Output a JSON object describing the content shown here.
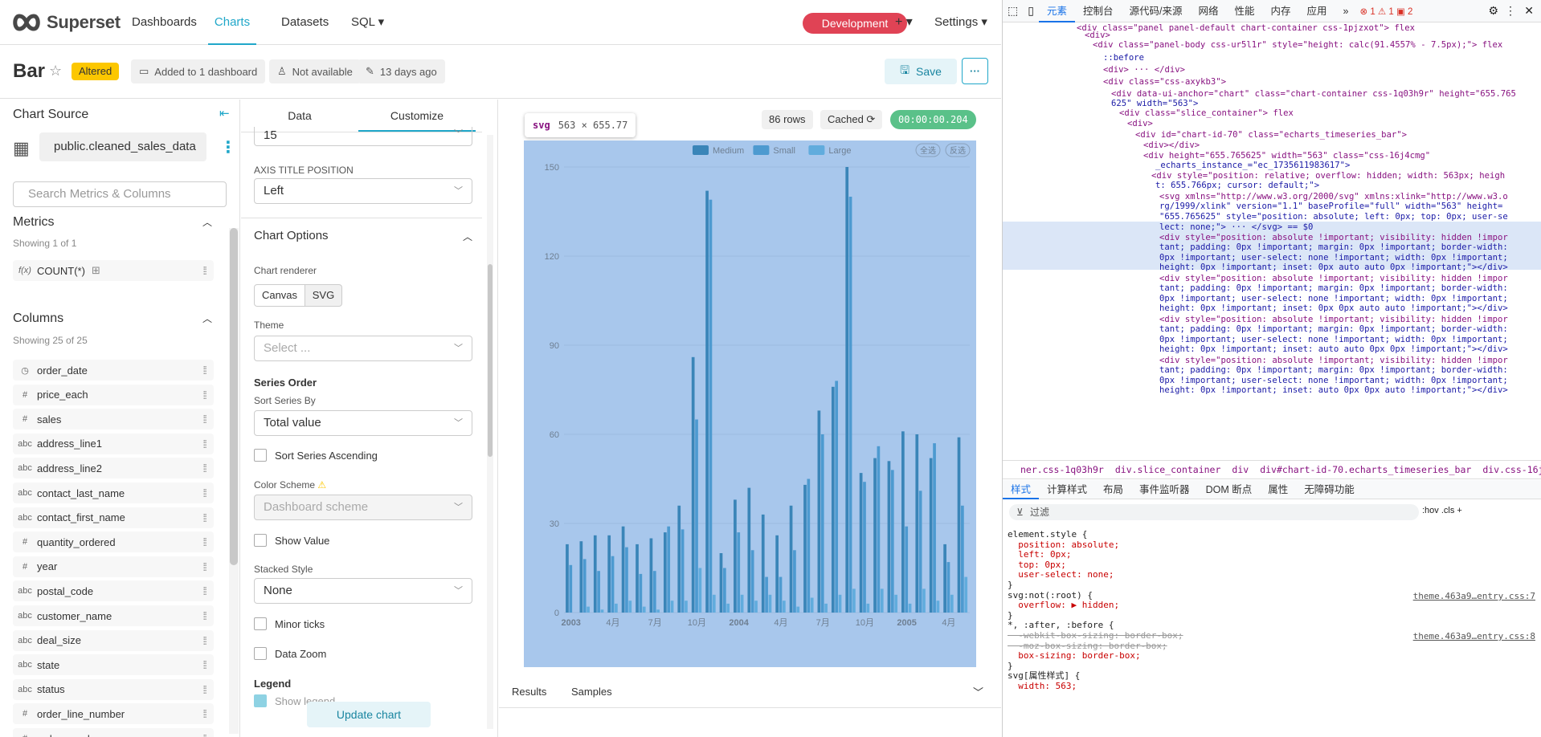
{
  "nav": {
    "brand": "Superset",
    "links": [
      "Dashboards",
      "Charts",
      "Datasets",
      "SQL ▾"
    ],
    "env_badge": "Development",
    "plus_label": "+ ▾",
    "settings": "Settings ▾"
  },
  "header": {
    "title": "Bar",
    "status": "Altered",
    "meta": [
      "Added to 1 dashboard",
      "Not available",
      "13 days ago"
    ],
    "save": "Save",
    "more": "···"
  },
  "left": {
    "chart_source": "Chart Source",
    "dataset": "public.cleaned_sales_data",
    "search_placeholder": "Search Metrics & Columns",
    "metrics_h": "Metrics",
    "metrics_showing": "Showing 1 of 1",
    "metric": {
      "type": "f(x)",
      "name": "COUNT(*)"
    },
    "columns_h": "Columns",
    "columns_showing": "Showing 25 of 25",
    "columns": [
      {
        "type": "◷",
        "name": "order_date"
      },
      {
        "type": "#",
        "name": "price_each"
      },
      {
        "type": "#",
        "name": "sales"
      },
      {
        "type": "abc",
        "name": "address_line1"
      },
      {
        "type": "abc",
        "name": "address_line2"
      },
      {
        "type": "abc",
        "name": "contact_last_name"
      },
      {
        "type": "abc",
        "name": "contact_first_name"
      },
      {
        "type": "#",
        "name": "quantity_ordered"
      },
      {
        "type": "#",
        "name": "year"
      },
      {
        "type": "abc",
        "name": "postal_code"
      },
      {
        "type": "abc",
        "name": "customer_name"
      },
      {
        "type": "abc",
        "name": "deal_size"
      },
      {
        "type": "abc",
        "name": "state"
      },
      {
        "type": "abc",
        "name": "status"
      },
      {
        "type": "#",
        "name": "order_line_number"
      },
      {
        "type": "#",
        "name": "order_number"
      }
    ]
  },
  "customize": {
    "tabs": [
      "Data",
      "Customize"
    ],
    "font_value": "15",
    "axis_title_position_label": "AXIS TITLE POSITION",
    "axis_title_position": "Left",
    "chart_options": "Chart Options",
    "renderer_label": "Chart renderer",
    "renderer_opts": [
      "Canvas",
      "SVG"
    ],
    "theme_label": "Theme",
    "theme_placeholder": "Select ...",
    "series_order": "Series Order",
    "sort_series_by_label": "Sort Series By",
    "sort_series_by": "Total value",
    "sort_asc": "Sort Series Ascending",
    "color_scheme_label": "Color Scheme",
    "color_scheme": "Dashboard scheme",
    "show_value": "Show Value",
    "stacked_style_label": "Stacked Style",
    "stacked_style": "None",
    "minor_ticks": "Minor ticks",
    "data_zoom": "Data Zoom",
    "legend": "Legend",
    "show_legend": "Show legend",
    "update_chart": "Update chart"
  },
  "chartpanel": {
    "rows": "86 rows",
    "cached": "Cached ⟳",
    "timer": "00:00:00.204",
    "svg_tip_tag": "svg",
    "svg_tip_size": "563 × 655.77",
    "results_tabs": [
      "Results",
      "Samples"
    ],
    "legend_actions": [
      "全选",
      "反选"
    ]
  },
  "chart_data": {
    "type": "bar",
    "legend": [
      "Medium",
      "Small",
      "Large"
    ],
    "ylim": [
      0,
      150
    ],
    "yticks": [
      0,
      30,
      60,
      90,
      120,
      150
    ],
    "xticks": [
      "2003",
      "4月",
      "7月",
      "10月",
      "2004",
      "4月",
      "7月",
      "10月",
      "2005",
      "4月"
    ],
    "series": [
      {
        "name": "Medium",
        "values": [
          23,
          24,
          26,
          26,
          29,
          23,
          25,
          27,
          36,
          86,
          142,
          20,
          38,
          42,
          33,
          26,
          36,
          43,
          68,
          76,
          150,
          47,
          52,
          51,
          61,
          60,
          52,
          23,
          59
        ]
      },
      {
        "name": "Small",
        "values": [
          16,
          18,
          14,
          19,
          22,
          13,
          14,
          29,
          28,
          65,
          139,
          15,
          27,
          21,
          12,
          12,
          21,
          45,
          60,
          78,
          140,
          44,
          56,
          48,
          29,
          41,
          57,
          17,
          36
        ]
      },
      {
        "name": "Large",
        "values": [
          0,
          2,
          1,
          3,
          4,
          2,
          1,
          4,
          4,
          15,
          6,
          3,
          6,
          4,
          6,
          4,
          2,
          5,
          3,
          6,
          8,
          3,
          8,
          6,
          3,
          8,
          4,
          6,
          12
        ]
      }
    ]
  },
  "devtools": {
    "tabs": [
      "元素",
      "控制台",
      "源代码/来源",
      "网络",
      "性能",
      "内存",
      "应用",
      "»"
    ],
    "errors": "⊗ 1  ⚠ 1  ▣ 2",
    "dom_lines": [
      "<div class=\"panel panel-default chart-container css-1pjzxot\"> flex",
      "<div>",
      "<div class=\"panel-body css-ur5l1r\" style=\"height: calc(91.4557% - 7.5px);\"> flex",
      "::before",
      "<div> ··· </div>",
      "<div class=\"css-axykb3\">",
      "<div data-ui-anchor=\"chart\" class=\"chart-container css-1q03h9r\" height=\"655.765",
      "625\" width=\"563\">",
      "<div class=\"slice_container\"> flex",
      "<div>",
      "<div id=\"chart-id-70\" class=\"echarts_timeseries_bar\">",
      "<div></div>",
      "<div height=\"655.765625\" width=\"563\" class=\"css-16j4cmg\"",
      "_echarts_instance_=\"ec_1735611983617\">",
      "<div style=\"position: relative; overflow: hidden; width: 563px; heigh",
      "t: 655.766px; cursor: default;\">",
      "<svg xmlns=\"http://www.w3.org/2000/svg\" xmlns:xlink=\"http://www.w3.o",
      "rg/1999/xlink\" version=\"1.1\" baseProfile=\"full\" width=\"563\" height=",
      "\"655.765625\" style=\"position: absolute; left: 0px; top: 0px; user-se",
      "lect: none;\"> ··· </svg> == $0",
      "<div style=\"position: absolute !important; visibility: hidden !impor",
      "tant; padding: 0px !important; margin: 0px !important; border-width:",
      "0px !important; user-select: none !important; width: 0px !important;",
      "height: 0px !important; inset: 0px auto auto 0px !important;\"></div>",
      "<div style=\"position: absolute !important; visibility: hidden !impor",
      "tant; padding: 0px !important; margin: 0px !important; border-width:",
      "0px !important; user-select: none !important; width: 0px !important;",
      "height: 0px !important; inset: 0px 0px auto auto !important;\"></div>",
      "<div style=\"position: absolute !important; visibility: hidden !impor",
      "tant; padding: 0px !important; margin: 0px !important; border-width:",
      "0px !important; user-select: none !important; width: 0px !important;",
      "height: 0px !important; inset: auto auto 0px 0px !important;\"></div>",
      "<div style=\"position: absolute !important; visibility: hidden !impor",
      "tant; padding: 0px !important; margin: 0px !important; border-width:",
      "0px !important; user-select: none !important; width: 0px !important;",
      "height: 0px !important; inset: auto 0px 0px auto !important;\"></div>"
    ],
    "crumbs": [
      "ner.css-1q03h9r",
      "div.slice_container",
      "div",
      "div#chart-id-70.echarts_timeseries_bar",
      "div.css-16j4cmg",
      "div",
      "svg"
    ],
    "subtabs": [
      "样式",
      "计算样式",
      "布局",
      "事件监听器",
      "DOM 断点",
      "属性",
      "无障碍功能"
    ],
    "filter": "过滤",
    "filter_tools": ":hov  .cls  +",
    "css_lines": [
      "element.style {",
      "  position: absolute;",
      "  left: 0px;",
      "  top: 0px;",
      "  user-select: none;",
      "}",
      "svg:not(:root) {",
      "  overflow: ▶ hidden;",
      "}",
      "*, :after, :before {",
      "  -webkit-box-sizing: border-box;",
      "  -moz-box-sizing: border-box;",
      "  box-sizing: border-box;",
      "}",
      "svg[属性样式] {",
      "  width: 563;"
    ],
    "css_sources": [
      "theme.463a9…entry.css:7",
      "theme.463a9…entry.css:8"
    ]
  },
  "colors": {
    "accent": "#20a7c9",
    "medium": "#3a85b8",
    "small": "#4d9ad0",
    "large": "#61acdd",
    "highlight": "#a8c7ec"
  }
}
